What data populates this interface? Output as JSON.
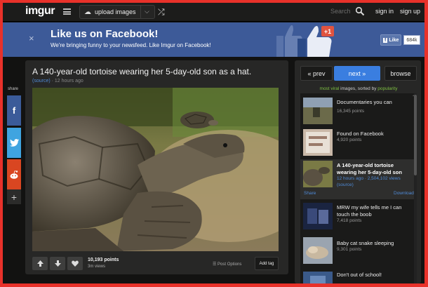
{
  "topnav": {
    "logo": "imgur",
    "upload_label": "upload images",
    "search_placeholder": "Search",
    "signin": "sign in",
    "signup": "sign up"
  },
  "fb_banner": {
    "close": "×",
    "title": "Like us on Facebook!",
    "subtitle": "We're bringing funny to your newsfeed. Like Imgur on Facebook!",
    "plus_one": "+1",
    "like_label": "Like",
    "like_count": "684k"
  },
  "share": {
    "label": "share",
    "more": "+"
  },
  "post": {
    "title": "A 140-year-old tortoise wearing her 5-day-old son as a hat.",
    "source": "(source)",
    "age": "· 12 hours ago",
    "points": "10,193 points",
    "views": "3m views",
    "post_options": "Post Options",
    "add_tag": "Add tag"
  },
  "nav": {
    "prev": "« prev",
    "next": "next »",
    "browse": "browse"
  },
  "sort": {
    "most_viral": "most viral",
    "middle": " images, sorted by ",
    "popularity": "popularity"
  },
  "gallery": [
    {
      "title": "Documentaries you can",
      "points": "16,345 points"
    },
    {
      "title": "Found on Facebook",
      "points": "4,920 points"
    },
    {
      "title": "A 140-year-old tortoise wearing her 5-day-old son",
      "meta": "12 hours ago · 2,504,102 views",
      "source": "(source)",
      "share": "Share",
      "download": "Download"
    },
    {
      "title": "MRW my wife tells me I can touch the boob",
      "points": "7,418 points"
    },
    {
      "title": "Baby cat snake sleeping",
      "points": "9,301 points"
    },
    {
      "title": "Don't out of school!",
      "points": ""
    }
  ]
}
